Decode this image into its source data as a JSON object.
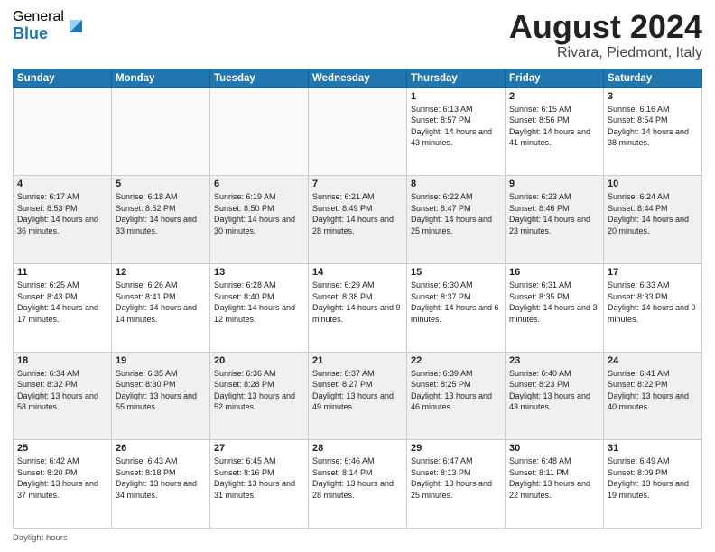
{
  "logo": {
    "general": "General",
    "blue": "Blue"
  },
  "title": "August 2024",
  "subtitle": "Rivara, Piedmont, Italy",
  "days_of_week": [
    "Sunday",
    "Monday",
    "Tuesday",
    "Wednesday",
    "Thursday",
    "Friday",
    "Saturday"
  ],
  "footer_text": "Daylight hours",
  "weeks": [
    [
      {
        "day": "",
        "info": ""
      },
      {
        "day": "",
        "info": ""
      },
      {
        "day": "",
        "info": ""
      },
      {
        "day": "",
        "info": ""
      },
      {
        "day": "1",
        "info": "Sunrise: 6:13 AM\nSunset: 8:57 PM\nDaylight: 14 hours and 43 minutes."
      },
      {
        "day": "2",
        "info": "Sunrise: 6:15 AM\nSunset: 8:56 PM\nDaylight: 14 hours and 41 minutes."
      },
      {
        "day": "3",
        "info": "Sunrise: 6:16 AM\nSunset: 8:54 PM\nDaylight: 14 hours and 38 minutes."
      }
    ],
    [
      {
        "day": "4",
        "info": "Sunrise: 6:17 AM\nSunset: 8:53 PM\nDaylight: 14 hours and 36 minutes."
      },
      {
        "day": "5",
        "info": "Sunrise: 6:18 AM\nSunset: 8:52 PM\nDaylight: 14 hours and 33 minutes."
      },
      {
        "day": "6",
        "info": "Sunrise: 6:19 AM\nSunset: 8:50 PM\nDaylight: 14 hours and 30 minutes."
      },
      {
        "day": "7",
        "info": "Sunrise: 6:21 AM\nSunset: 8:49 PM\nDaylight: 14 hours and 28 minutes."
      },
      {
        "day": "8",
        "info": "Sunrise: 6:22 AM\nSunset: 8:47 PM\nDaylight: 14 hours and 25 minutes."
      },
      {
        "day": "9",
        "info": "Sunrise: 6:23 AM\nSunset: 8:46 PM\nDaylight: 14 hours and 23 minutes."
      },
      {
        "day": "10",
        "info": "Sunrise: 6:24 AM\nSunset: 8:44 PM\nDaylight: 14 hours and 20 minutes."
      }
    ],
    [
      {
        "day": "11",
        "info": "Sunrise: 6:25 AM\nSunset: 8:43 PM\nDaylight: 14 hours and 17 minutes."
      },
      {
        "day": "12",
        "info": "Sunrise: 6:26 AM\nSunset: 8:41 PM\nDaylight: 14 hours and 14 minutes."
      },
      {
        "day": "13",
        "info": "Sunrise: 6:28 AM\nSunset: 8:40 PM\nDaylight: 14 hours and 12 minutes."
      },
      {
        "day": "14",
        "info": "Sunrise: 6:29 AM\nSunset: 8:38 PM\nDaylight: 14 hours and 9 minutes."
      },
      {
        "day": "15",
        "info": "Sunrise: 6:30 AM\nSunset: 8:37 PM\nDaylight: 14 hours and 6 minutes."
      },
      {
        "day": "16",
        "info": "Sunrise: 6:31 AM\nSunset: 8:35 PM\nDaylight: 14 hours and 3 minutes."
      },
      {
        "day": "17",
        "info": "Sunrise: 6:33 AM\nSunset: 8:33 PM\nDaylight: 14 hours and 0 minutes."
      }
    ],
    [
      {
        "day": "18",
        "info": "Sunrise: 6:34 AM\nSunset: 8:32 PM\nDaylight: 13 hours and 58 minutes."
      },
      {
        "day": "19",
        "info": "Sunrise: 6:35 AM\nSunset: 8:30 PM\nDaylight: 13 hours and 55 minutes."
      },
      {
        "day": "20",
        "info": "Sunrise: 6:36 AM\nSunset: 8:28 PM\nDaylight: 13 hours and 52 minutes."
      },
      {
        "day": "21",
        "info": "Sunrise: 6:37 AM\nSunset: 8:27 PM\nDaylight: 13 hours and 49 minutes."
      },
      {
        "day": "22",
        "info": "Sunrise: 6:39 AM\nSunset: 8:25 PM\nDaylight: 13 hours and 46 minutes."
      },
      {
        "day": "23",
        "info": "Sunrise: 6:40 AM\nSunset: 8:23 PM\nDaylight: 13 hours and 43 minutes."
      },
      {
        "day": "24",
        "info": "Sunrise: 6:41 AM\nSunset: 8:22 PM\nDaylight: 13 hours and 40 minutes."
      }
    ],
    [
      {
        "day": "25",
        "info": "Sunrise: 6:42 AM\nSunset: 8:20 PM\nDaylight: 13 hours and 37 minutes."
      },
      {
        "day": "26",
        "info": "Sunrise: 6:43 AM\nSunset: 8:18 PM\nDaylight: 13 hours and 34 minutes."
      },
      {
        "day": "27",
        "info": "Sunrise: 6:45 AM\nSunset: 8:16 PM\nDaylight: 13 hours and 31 minutes."
      },
      {
        "day": "28",
        "info": "Sunrise: 6:46 AM\nSunset: 8:14 PM\nDaylight: 13 hours and 28 minutes."
      },
      {
        "day": "29",
        "info": "Sunrise: 6:47 AM\nSunset: 8:13 PM\nDaylight: 13 hours and 25 minutes."
      },
      {
        "day": "30",
        "info": "Sunrise: 6:48 AM\nSunset: 8:11 PM\nDaylight: 13 hours and 22 minutes."
      },
      {
        "day": "31",
        "info": "Sunrise: 6:49 AM\nSunset: 8:09 PM\nDaylight: 13 hours and 19 minutes."
      }
    ]
  ]
}
